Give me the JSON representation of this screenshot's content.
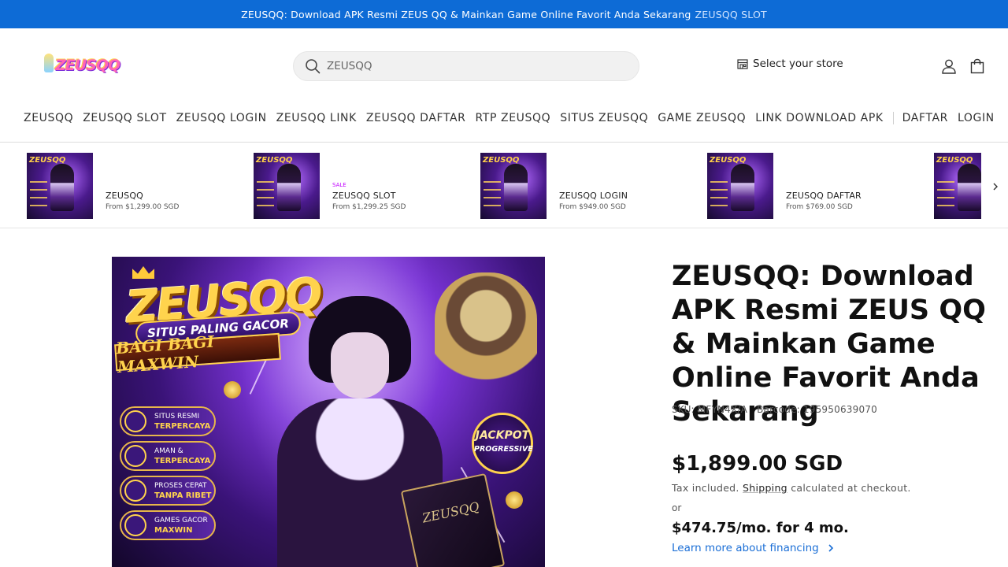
{
  "announcement": {
    "text": "ZEUSQQ: Download APK Resmi ZEUS QQ & Mainkan Game Online Favorit Anda Sekarang",
    "link": "ZEUSQQ SLOT",
    "bg_color": "#0d6bd6"
  },
  "header": {
    "logo_text": "ZEUSQQ",
    "search_placeholder": "ZEUSQQ",
    "store_label": "Select your store",
    "account_icon": "person-icon",
    "cart_icon": "shopping-bag-icon"
  },
  "nav": {
    "items": [
      "ZEUSQQ",
      "ZEUSQQ SLOT",
      "ZEUSQQ LOGIN",
      "ZEUSQQ LINK",
      "ZEUSQQ DAFTAR",
      "RTP ZEUSQQ",
      "SITUS ZEUSQQ",
      "GAME ZEUSQQ",
      "LINK DOWNLOAD APK"
    ],
    "auth": [
      "DAFTAR",
      "LOGIN"
    ]
  },
  "strip": {
    "thumb_title": "ZEUSQQ",
    "items": [
      {
        "sale": "",
        "name": "ZEUSQQ",
        "price": "From $1,299.00 SGD"
      },
      {
        "sale": "SALE",
        "name": "ZEUSQQ SLOT",
        "price": "From $1,299.25 SGD"
      },
      {
        "sale": "",
        "name": "ZEUSQQ LOGIN",
        "price": "From $949.00 SGD"
      },
      {
        "sale": "",
        "name": "ZEUSQQ DAFTAR",
        "price": "From $769.00 SGD"
      }
    ]
  },
  "hero": {
    "title": "ZEUSQQ",
    "ribbon1": "SITUS PALING GACOR",
    "ribbon2": "BAGI BAGI MAXWIN",
    "features": [
      {
        "line1": "SITUS RESMI",
        "line2": "TERPERCAYA"
      },
      {
        "line1": "AMAN &",
        "line2": "TERPERCAYA"
      },
      {
        "line1": "PROSES CEPAT",
        "line2": "TANPA RIBET"
      },
      {
        "line1": "GAMES GACOR",
        "line2": "MAXWIN"
      }
    ],
    "badge_line1": "JACKPOT",
    "badge_line2": "PROGRESSIVE",
    "book_text": "ZEUSQQ"
  },
  "product": {
    "title": "ZEUSQQ: Download APK Resmi ZEUS QQ & Mainkan Game Online Favorit Anda Sekarang",
    "sku": "SKU: MFYN4X/A",
    "barcode": "Barcode: 195950639070",
    "price": "$1,899.00 SGD",
    "tax_prefix": "Tax included.",
    "shipping": "Shipping",
    "tax_suffix": "calculated at checkout.",
    "or": "or",
    "monthly": "$474.75/mo. for 4 mo.",
    "learn_more": "Learn more about financing",
    "link_color": "#1a6ed6"
  }
}
